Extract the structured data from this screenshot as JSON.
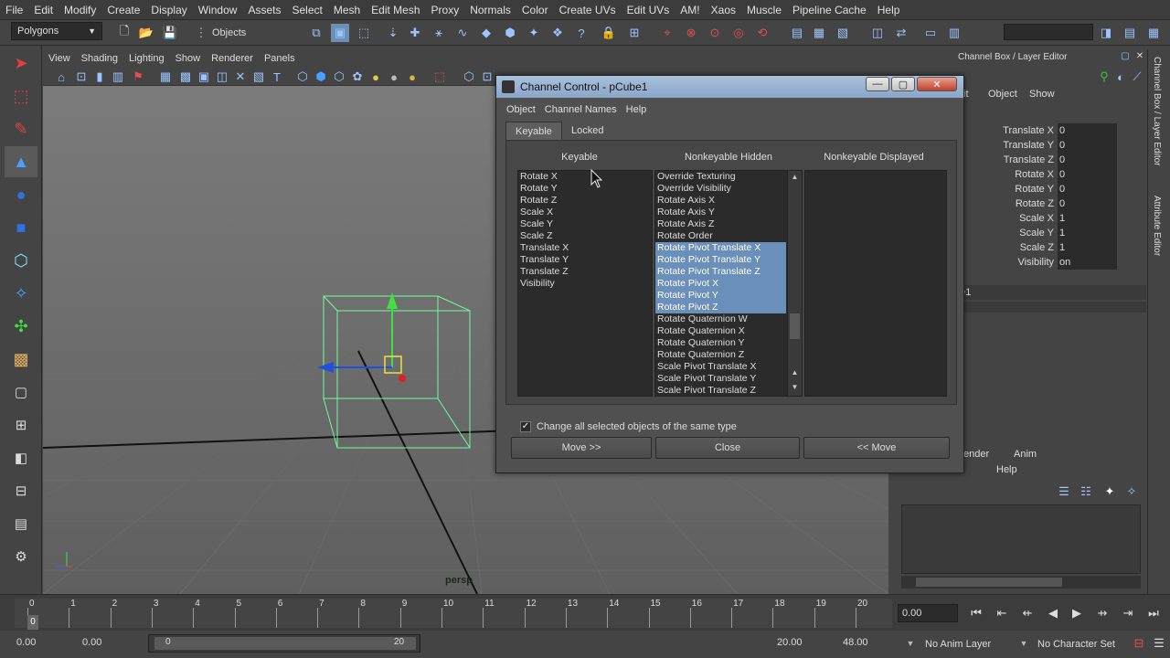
{
  "menubar": [
    "File",
    "Edit",
    "Modify",
    "Create",
    "Display",
    "Window",
    "Assets",
    "Select",
    "Mesh",
    "Edit Mesh",
    "Proxy",
    "Normals",
    "Color",
    "Create UVs",
    "Edit UVs",
    "AM!",
    "Xaos",
    "Muscle",
    "Pipeline Cache",
    "Help"
  ],
  "status": {
    "menuset": "Polygons",
    "objects_label": "Objects"
  },
  "viewport": {
    "menu": [
      "View",
      "Shading",
      "Lighting",
      "Show",
      "Renderer",
      "Panels"
    ],
    "camera_label": "persp"
  },
  "channelbox": {
    "title": "Channel Box / Layer Editor",
    "menu": [
      "Object",
      "Show"
    ],
    "edge_menu_fragment": "it",
    "object_fragment": "be1",
    "side_tabs": [
      "Channel Box / Layer Editor",
      "Attribute Editor"
    ],
    "channels": [
      {
        "label": "Translate X",
        "value": "0"
      },
      {
        "label": "Translate Y",
        "value": "0"
      },
      {
        "label": "Translate Z",
        "value": "0"
      },
      {
        "label": "Rotate X",
        "value": "0"
      },
      {
        "label": "Rotate Y",
        "value": "0"
      },
      {
        "label": "Rotate Z",
        "value": "0"
      },
      {
        "label": "Scale X",
        "value": "1"
      },
      {
        "label": "Scale Y",
        "value": "1"
      },
      {
        "label": "Scale Z",
        "value": "1"
      },
      {
        "label": "Visibility",
        "value": "on"
      }
    ],
    "layer_tabs": [
      "ender",
      "Anim"
    ],
    "layer_menu": [
      "ons",
      "Help"
    ]
  },
  "dialog": {
    "title": "Channel Control - pCube1",
    "menu": [
      "Object",
      "Channel Names",
      "Help"
    ],
    "tabs": [
      "Keyable",
      "Locked"
    ],
    "col_keyable": "Keyable",
    "col_hidden": "Nonkeyable Hidden",
    "col_displayed": "Nonkeyable Displayed",
    "keyable_items": [
      "Rotate X",
      "Rotate Y",
      "Rotate Z",
      "Scale X",
      "Scale Y",
      "Scale Z",
      "Translate X",
      "Translate Y",
      "Translate Z",
      "Visibility"
    ],
    "hidden_items": [
      {
        "label": "Override Texturing",
        "selected": false
      },
      {
        "label": "Override Visibility",
        "selected": false
      },
      {
        "label": "Rotate Axis X",
        "selected": false
      },
      {
        "label": "Rotate Axis Y",
        "selected": false
      },
      {
        "label": "Rotate Axis Z",
        "selected": false
      },
      {
        "label": "Rotate Order",
        "selected": false
      },
      {
        "label": "Rotate Pivot Translate X",
        "selected": true
      },
      {
        "label": "Rotate Pivot Translate Y",
        "selected": true
      },
      {
        "label": "Rotate Pivot Translate Z",
        "selected": true
      },
      {
        "label": "Rotate Pivot X",
        "selected": true
      },
      {
        "label": "Rotate Pivot Y",
        "selected": true
      },
      {
        "label": "Rotate Pivot Z",
        "selected": true
      },
      {
        "label": "Rotate Quaternion W",
        "selected": false
      },
      {
        "label": "Rotate Quaternion X",
        "selected": false
      },
      {
        "label": "Rotate Quaternion Y",
        "selected": false
      },
      {
        "label": "Rotate Quaternion Z",
        "selected": false
      },
      {
        "label": "Scale Pivot Translate X",
        "selected": false
      },
      {
        "label": "Scale Pivot Translate Y",
        "selected": false
      },
      {
        "label": "Scale Pivot Translate Z",
        "selected": false
      }
    ],
    "checkbox_label": "Change all selected objects of the same type",
    "checkbox_checked": true,
    "btn_move_right": "Move >>",
    "btn_close": "Close",
    "btn_move_left": "<< Move"
  },
  "timeline": {
    "ticks": [
      "0",
      "1",
      "2",
      "3",
      "4",
      "5",
      "6",
      "7",
      "8",
      "9",
      "10",
      "11",
      "12",
      "13",
      "14",
      "15",
      "16",
      "17",
      "18",
      "19",
      "20"
    ],
    "current_frame": "0",
    "frame_field": "0.00"
  },
  "range": {
    "start": "0.00",
    "playback_start": "0.00",
    "slider_start": "0",
    "slider_end": "20",
    "playback_end": "20.00",
    "end": "48.00",
    "anim_layer": "No Anim Layer",
    "character_set": "No Character Set"
  }
}
